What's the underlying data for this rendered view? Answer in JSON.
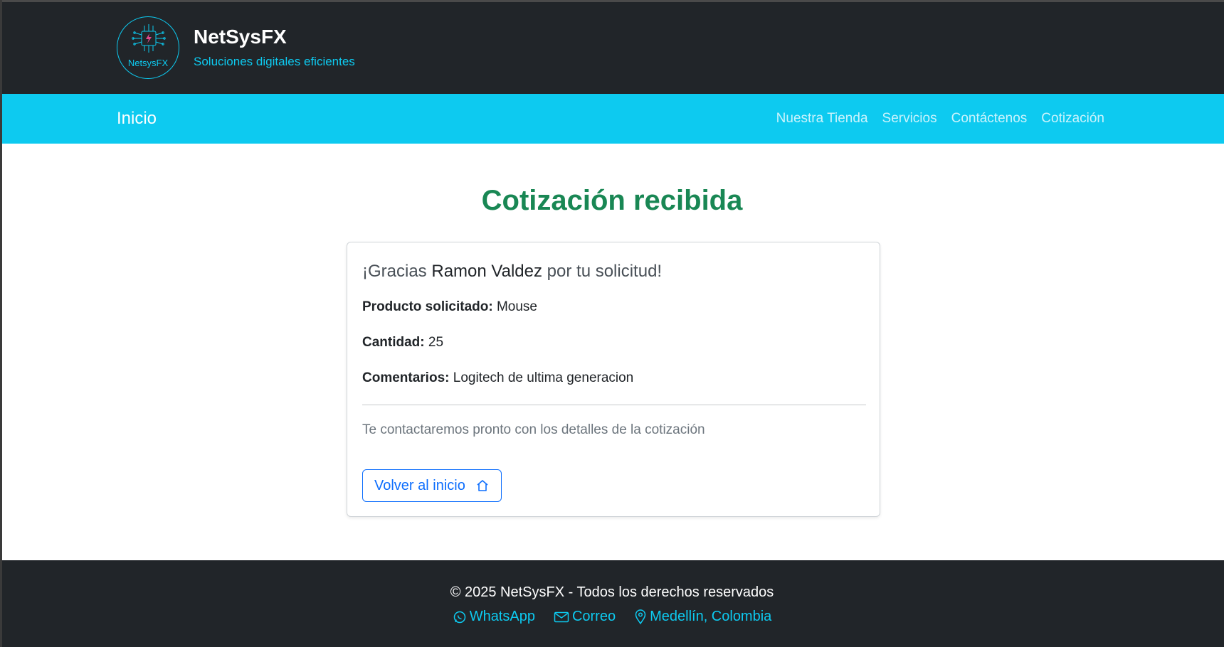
{
  "brand": {
    "logo_text": "NetsysFX",
    "title": "NetSysFX",
    "tagline": "Soluciones digitales eficientes",
    "accent_color": "#0dcaf0"
  },
  "nav": {
    "home": "Inicio",
    "links": [
      "Nuestra Tienda",
      "Servicios",
      "Contáctenos",
      "Cotización"
    ]
  },
  "main": {
    "title": "Cotización recibida",
    "greeting_prefix": "¡Gracias",
    "customer_name": "Ramon Valdez",
    "greeting_suffix": "por tu solicitud!",
    "product_label": "Producto solicitado:",
    "product_value": "Mouse",
    "quantity_label": "Cantidad:",
    "quantity_value": "25",
    "comments_label": "Comentarios:",
    "comments_value": "Logitech de ultima generacion",
    "note": "Te contactaremos pronto con los detalles de la cotización",
    "back_button": "Volver al inicio",
    "back_icon": "house-icon"
  },
  "footer": {
    "copyright": "© 2025 NetSysFX - Todos los derechos reservados",
    "whatsapp": "WhatsApp",
    "email": "Correo",
    "location": "Medellín, Colombia"
  }
}
